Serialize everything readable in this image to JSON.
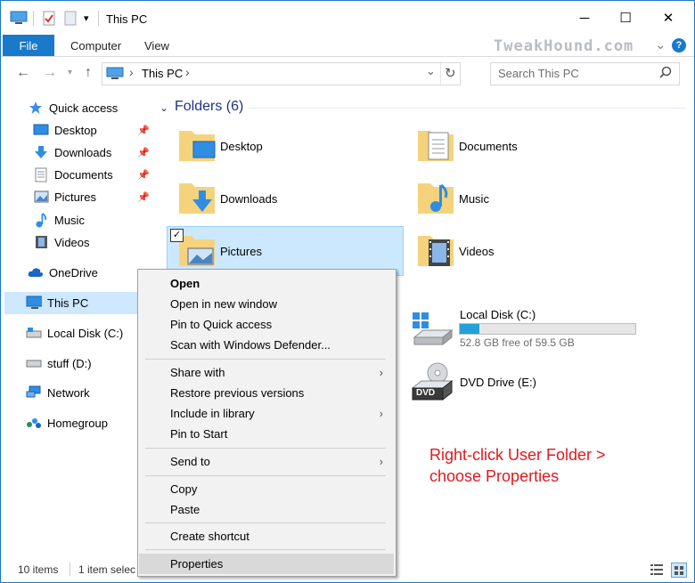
{
  "window": {
    "title": "This PC",
    "accent": "#1979ca",
    "caption_buttons": {
      "minimize": "─",
      "maximize": "☐",
      "close": "✕"
    }
  },
  "ribbon": {
    "tabs": [
      {
        "label": "File"
      },
      {
        "label": "Computer"
      },
      {
        "label": "View"
      }
    ],
    "brand": "TweakHound.com",
    "expand_glyph": "⌄",
    "help_glyph": "?"
  },
  "address": {
    "path_root_glyph": "›",
    "path": "This PC",
    "path_chevron": "›",
    "dropdown_glyph": "⌄",
    "refresh_glyph": "↻"
  },
  "search": {
    "placeholder": "Search This PC"
  },
  "nav": {
    "items": [
      {
        "label": "Quick access",
        "icon": "star-icon"
      },
      {
        "label": "Desktop",
        "icon": "desktop-icon",
        "pinned": true
      },
      {
        "label": "Downloads",
        "icon": "download-icon",
        "pinned": true
      },
      {
        "label": "Documents",
        "icon": "document-icon",
        "pinned": true
      },
      {
        "label": "Pictures",
        "icon": "pictures-icon",
        "pinned": true
      },
      {
        "label": "Music",
        "icon": "music-icon"
      },
      {
        "label": "Videos",
        "icon": "video-icon"
      },
      {
        "label": "OneDrive",
        "icon": "cloud-icon"
      },
      {
        "label": "This PC",
        "icon": "computer-icon",
        "selected": true
      },
      {
        "label": "Local Disk (C:)",
        "icon": "drive-icon"
      },
      {
        "label": "stuff (D:)",
        "icon": "drive-icon"
      },
      {
        "label": "Network",
        "icon": "network-icon"
      },
      {
        "label": "Homegroup",
        "icon": "homegroup-icon"
      }
    ]
  },
  "content": {
    "group_header": "Folders (6)",
    "folders": [
      {
        "label": "Desktop"
      },
      {
        "label": "Documents"
      },
      {
        "label": "Downloads"
      },
      {
        "label": "Music"
      },
      {
        "label": "Pictures"
      },
      {
        "label": "Videos"
      }
    ],
    "drives": [
      {
        "label": "Local Disk (C:)",
        "free_text": "52.8 GB free of 59.5 GB",
        "used_fraction": 0.113
      },
      {
        "label": "DVD Drive (E:)",
        "badge": "DVD"
      }
    ]
  },
  "context_menu": {
    "items": [
      {
        "label": "Open",
        "bold": true
      },
      {
        "label": "Open in new window"
      },
      {
        "label": "Pin to Quick access"
      },
      {
        "label": "Scan with Windows Defender..."
      },
      {
        "label": "Share with",
        "submenu": true
      },
      {
        "label": "Restore previous versions"
      },
      {
        "label": "Include in library",
        "submenu": true
      },
      {
        "label": "Pin to Start"
      },
      {
        "label": "Send to",
        "submenu": true
      },
      {
        "label": "Copy"
      },
      {
        "label": "Paste"
      },
      {
        "label": "Create shortcut"
      },
      {
        "label": "Properties",
        "highlighted": true
      }
    ],
    "submenu_glyph": "›"
  },
  "annotation": {
    "line1": "Right-click User Folder >",
    "line2": "choose Properties",
    "color": "#e0191f"
  },
  "status": {
    "items_count": "10 items",
    "selection": "1 item selec"
  }
}
